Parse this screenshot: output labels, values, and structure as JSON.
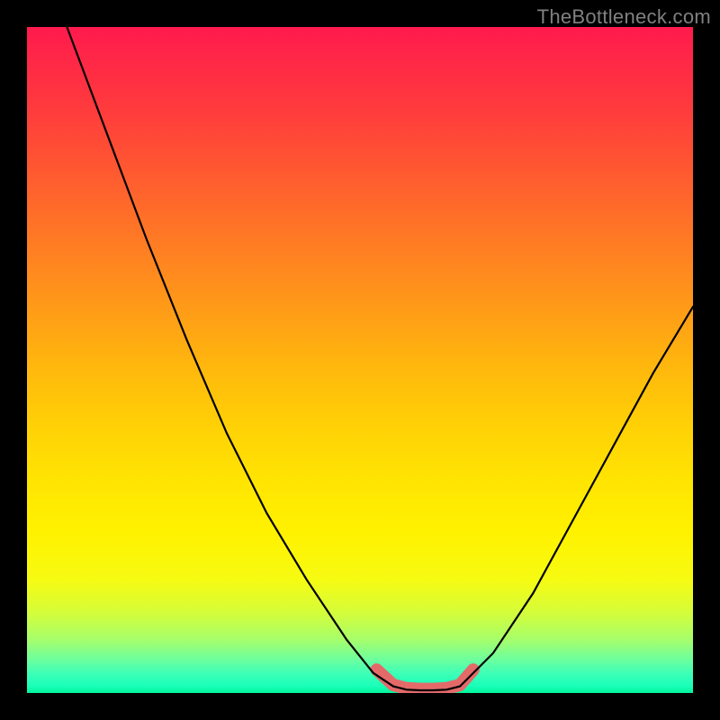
{
  "watermark": "TheBottleneck.com",
  "chart_data": {
    "type": "line",
    "title": "",
    "xlabel": "",
    "ylabel": "",
    "xlim": [
      0,
      100
    ],
    "ylim": [
      0,
      100
    ],
    "grid": false,
    "series": [
      {
        "name": "left-curve",
        "x": [
          6,
          12,
          18,
          24,
          30,
          36,
          42,
          48,
          52,
          55
        ],
        "y": [
          100,
          84,
          68,
          53,
          39,
          27,
          17,
          8,
          3,
          1
        ]
      },
      {
        "name": "valley-floor",
        "x": [
          55,
          57,
          59,
          61,
          63,
          65
        ],
        "y": [
          1,
          0.5,
          0.4,
          0.4,
          0.5,
          1
        ]
      },
      {
        "name": "right-curve",
        "x": [
          65,
          70,
          76,
          82,
          88,
          94,
          100
        ],
        "y": [
          1,
          6,
          15,
          26,
          37,
          48,
          58
        ]
      },
      {
        "name": "highlight-band",
        "x": [
          52.5,
          55,
          57,
          59,
          61,
          63,
          65,
          67
        ],
        "y": [
          3.5,
          1.2,
          0.7,
          0.6,
          0.6,
          0.7,
          1.2,
          3.5
        ]
      }
    ],
    "annotations": []
  }
}
